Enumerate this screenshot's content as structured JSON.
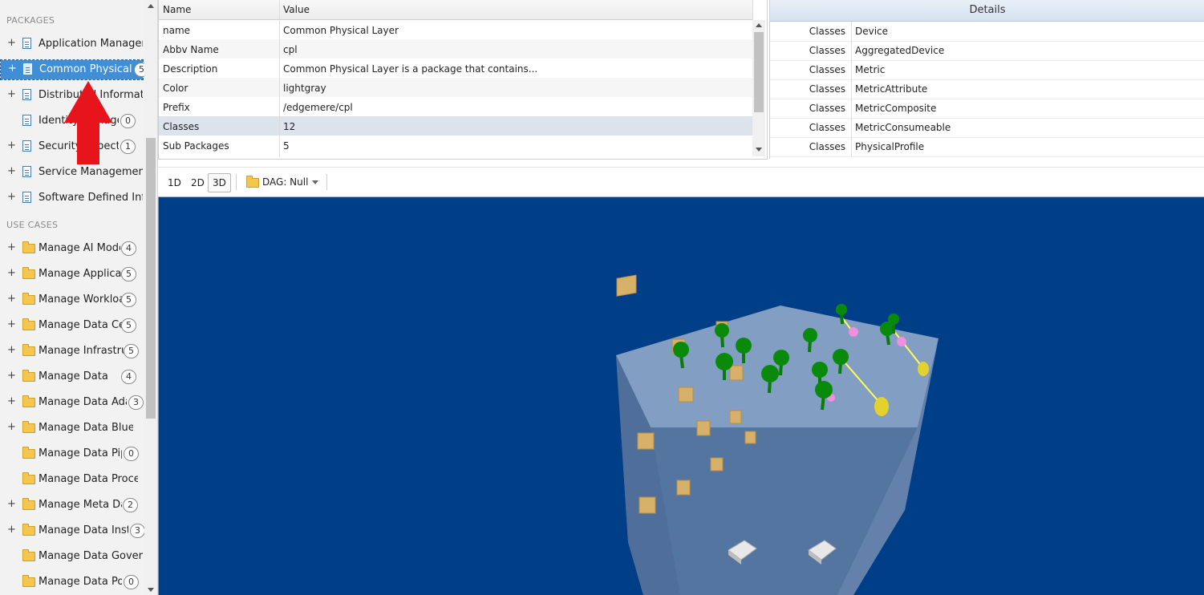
{
  "sidebar": {
    "packages_header": "PACKAGES",
    "use_cases_header": "USE CASES",
    "packages": [
      {
        "label": "Application Management",
        "count": "",
        "plus": "+"
      },
      {
        "label": "Common Physical Layer",
        "count": "5",
        "plus": "+"
      },
      {
        "label": "Distributed Information",
        "count": "",
        "plus": "+"
      },
      {
        "label": "Identity Management",
        "count": "0",
        "plus": ""
      },
      {
        "label": "Security Aspect",
        "count": "1",
        "plus": "+"
      },
      {
        "label": "Service Management",
        "count": "",
        "plus": "+"
      },
      {
        "label": "Software Defined Infrastructure",
        "count": "",
        "plus": "+"
      }
    ],
    "use_cases": [
      {
        "label": "Manage AI Models",
        "count": "4",
        "plus": "+"
      },
      {
        "label": "Manage Applications",
        "count": "5",
        "plus": "+"
      },
      {
        "label": "Manage Workloads",
        "count": "5",
        "plus": "+"
      },
      {
        "label": "Manage Data Centers",
        "count": "5",
        "plus": "+"
      },
      {
        "label": "Manage Infrastructure",
        "count": "5",
        "plus": "+"
      },
      {
        "label": "Manage Data",
        "count": "4",
        "plus": "+"
      },
      {
        "label": "Manage Data Adapters",
        "count": "3",
        "plus": "+"
      },
      {
        "label": "Manage Data Blue Prints",
        "count": "",
        "plus": "+"
      },
      {
        "label": "Manage Data Pipelines",
        "count": "0",
        "plus": ""
      },
      {
        "label": "Manage Data Procedures",
        "count": "",
        "plus": ""
      },
      {
        "label": "Manage Meta Data",
        "count": "2",
        "plus": "+"
      },
      {
        "label": "Manage Data Instances",
        "count": "3",
        "plus": "+"
      },
      {
        "label": "Manage Data Governance",
        "count": "",
        "plus": ""
      },
      {
        "label": "Manage Data Policies",
        "count": "0",
        "plus": ""
      }
    ]
  },
  "properties": {
    "col_name": "Name",
    "col_value": "Value",
    "rows": [
      {
        "name": "name",
        "value": "Common Physical Layer"
      },
      {
        "name": "Abbv Name",
        "value": "cpl"
      },
      {
        "name": "Description",
        "value": "Common Physical Layer is a package that contains..."
      },
      {
        "name": "Color",
        "value": "lightgray"
      },
      {
        "name": "Prefix",
        "value": "/edgemere/cpl"
      },
      {
        "name": "Classes",
        "value": "12"
      },
      {
        "name": "Sub Packages",
        "value": "5"
      }
    ]
  },
  "details": {
    "title": "Details",
    "rows": [
      {
        "key": "Classes",
        "value": "Device"
      },
      {
        "key": "Classes",
        "value": "AggregatedDevice"
      },
      {
        "key": "Classes",
        "value": "Metric"
      },
      {
        "key": "Classes",
        "value": "MetricAttribute"
      },
      {
        "key": "Classes",
        "value": "MetricComposite"
      },
      {
        "key": "Classes",
        "value": "MetricConsumeable"
      },
      {
        "key": "Classes",
        "value": "PhysicalProfile"
      }
    ]
  },
  "toolbar": {
    "btn_1d": "1D",
    "btn_2d": "2D",
    "btn_3d": "3D",
    "active_view": "3D",
    "dag_label": "DAG: Null"
  },
  "colors": {
    "viewport_bg": "#003f87",
    "selection": "#3f8ed6",
    "annotation_arrow": "#e8141c"
  }
}
